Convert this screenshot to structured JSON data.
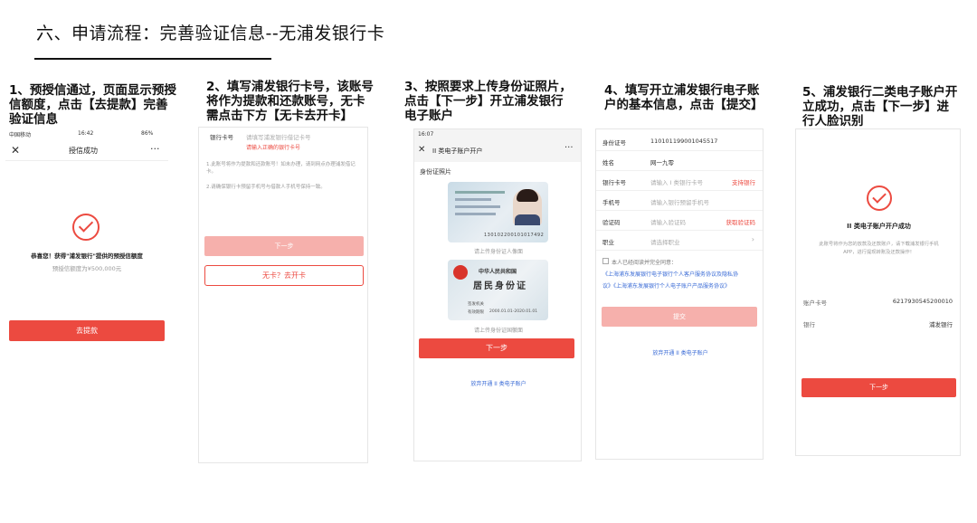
{
  "title": "六、申请流程：完善验证信息--无浦发银行卡",
  "steps": [
    {
      "text": "1、预授信通过，页面显示预授信额度，点击【去提款】完善验证信息"
    },
    {
      "text": "2、填写浦发银行卡号，该账号将作为提款和还款账号，无卡需点击下方【无卡去开卡】"
    },
    {
      "text": "3、按照要求上传身份证照片，点击【下一步】开立浦发银行电子账户"
    },
    {
      "text": "4、填写开立浦发银行电子账户的基本信息，点击【提交】"
    },
    {
      "text": "5、浦发银行二类电子账户开立成功，点击【下一步】进行人脸识别"
    }
  ],
  "screen1": {
    "status_carrier": "中国移动",
    "status_time": "16:42",
    "status_battery": "86%",
    "nav_title": "授信成功",
    "close_icon": "close-icon",
    "more_icon": "more-icon",
    "congrats": "恭喜您！获得\"浦发银行\"提供的预授信额度",
    "limit": "预授信额度为¥500,000元",
    "button": "去提款"
  },
  "screen2": {
    "field_label": "银行卡号",
    "field_placeholder": "请填写浦发银行借记卡号",
    "error": "请输入正确的银行卡号",
    "note1": "1.此账号将作为提款和还款账号！如未办理，请到网点办理浦发借记卡。",
    "note2": "2.请确保银行卡预留手机号与借款人手机号保持一致。",
    "next_button": "下一步",
    "nocard_button": "无卡？去开卡"
  },
  "screen3": {
    "status_time": "16:07",
    "nav_title": "II 类电子账户开户",
    "section": "身份证照片",
    "front_caption": "请上传身份证人像面",
    "back_caption": "请上传身份证国徽面",
    "card_front_number": "130102200101017492",
    "card_back_title1": "中华人民共和国",
    "card_back_title2": "居民身份证",
    "card_back_line1": "签发机关",
    "card_back_line2": "有效期限",
    "card_back_validity": "2000.01.01-2020.01.01",
    "next_button": "下一步",
    "abandon_link": "放弃开通 II 类电子账户"
  },
  "screen4": {
    "rows": [
      {
        "label": "身份证号",
        "value": "110101199001045517",
        "action": ""
      },
      {
        "label": "姓名",
        "value": "网一九零",
        "action": ""
      },
      {
        "label": "银行卡号",
        "value": "请输入 I 类银行卡号",
        "action": "支持银行"
      },
      {
        "label": "手机号",
        "value": "请输入银行预留手机号",
        "action": ""
      },
      {
        "label": "验证码",
        "value": "请输入验证码",
        "action": "获取验证码"
      },
      {
        "label": "职业",
        "value": "请选择职业",
        "action": ""
      }
    ],
    "agree": "本人已经阅读并完全同意：",
    "agreement_link1": "《上海浦东发展银行电子银行个人客户服务协议及隐私协",
    "agreement_link2": "议》《上海浦东发展银行个人电子账户产品服务协议》",
    "submit_button": "提交",
    "abandon_link": "放弃开通 II 类电子账户"
  },
  "screen5": {
    "success_title": "II 类电子账户开户成功",
    "success_desc1": "此账号将作为您的放款及还款账户，请下载浦发银行手机",
    "success_desc2": "APP，进行提现转账及还款操作！",
    "account_label": "账户卡号",
    "account_value": "6217930545200010",
    "bank_label": "银行",
    "bank_value": "浦发银行",
    "next_button": "下一步"
  },
  "colors": {
    "accent": "#ec4a40",
    "accent_light": "#f6b0ac",
    "link": "#3a6bd6"
  }
}
